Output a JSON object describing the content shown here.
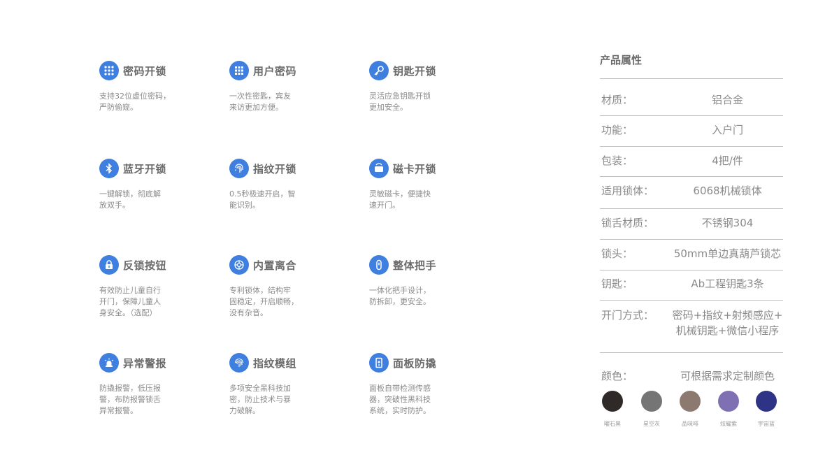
{
  "features": [
    {
      "title": "密码开锁",
      "desc": "支持32位虚位密码，\n严防偷窥。",
      "icon": "keypad-icon"
    },
    {
      "title": "用户密码",
      "desc": "一次性密匙，宾友\n来访更加方便。",
      "icon": "keypad-icon"
    },
    {
      "title": "钥匙开锁",
      "desc": "灵活应急钥匙开锁\n更加安全。",
      "icon": "key-icon"
    },
    {
      "title": "蓝牙开锁",
      "desc": "一键解锁，彻底解\n放双手。",
      "icon": "bluetooth-icon"
    },
    {
      "title": "指纹开锁",
      "desc": "0.5秒极速开启，智\n能识别。",
      "icon": "fingerprint-icon"
    },
    {
      "title": "磁卡开锁",
      "desc": "灵敏磁卡，便捷快\n速开门。",
      "icon": "card-icon"
    },
    {
      "title": "反锁按钮",
      "desc": "有效防止儿童自行\n开门，保障儿童人\n身安全。（选配）",
      "icon": "lock-icon"
    },
    {
      "title": "内置离合",
      "desc": "专利锁体，结构牢\n固稳定，开启顺畅，\n没有杂音。",
      "icon": "clutch-icon"
    },
    {
      "title": "整体把手",
      "desc": "一体化把手设计，\n防拆卸，更安全。",
      "icon": "handle-icon"
    },
    {
      "title": "异常警报",
      "desc": "防撬报警，低压报\n警，布防报警锁舌\n异常报警。",
      "icon": "alarm-icon"
    },
    {
      "title": "指纹模组",
      "desc": "多项安全黑科技加\n密，防止技术与暴\n力破解。",
      "icon": "fingerprint-icon"
    },
    {
      "title": "面板防撬",
      "desc": "面板自带检测传感\n器，突破性黑科技\n系统，实时防护。",
      "icon": "panel-icon"
    }
  ],
  "specs": {
    "title": "产品属性",
    "rows": [
      {
        "label": "材质：",
        "value": "铝合金"
      },
      {
        "label": "功能：",
        "value": "入户门"
      },
      {
        "label": "包装：",
        "value": "4把/件"
      },
      {
        "label": "适用锁体：",
        "value": "6068机械锁体"
      },
      {
        "label": "锁舌材质：",
        "value": "不锈钢304"
      },
      {
        "label": "锁头：",
        "value": "50mm单边真葫芦锁芯"
      },
      {
        "label": "钥匙：",
        "value": "Ab工程钥匙3条"
      },
      {
        "label": "开门方式：",
        "value": "密码+指纹+射频感应+\n机械钥匙+微信小程序"
      },
      {
        "label": "颜色：",
        "value": "可根据需求定制颜色"
      }
    ]
  },
  "colors": [
    {
      "name": "曜石黑",
      "hex": "#2f2a28"
    },
    {
      "name": "星空灰",
      "hex": "#757575"
    },
    {
      "name": "品味啡",
      "hex": "#8c7a70"
    },
    {
      "name": "炫耀紫",
      "hex": "#7f70b3"
    },
    {
      "name": "宇宙蓝",
      "hex": "#2e3386"
    }
  ],
  "accent": "#3f7fe0"
}
